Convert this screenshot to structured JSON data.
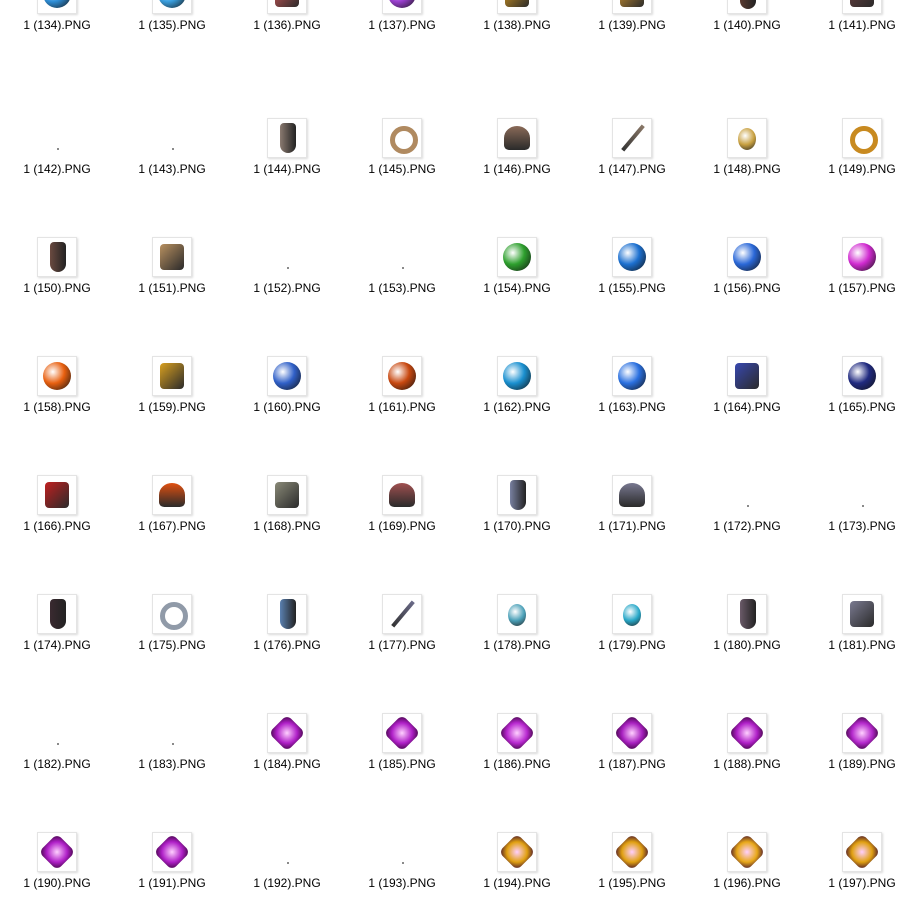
{
  "files": [
    {
      "name": "1 (134).PNG",
      "icon": "blue-gem-icon",
      "color": "#2f8fd8"
    },
    {
      "name": "1 (135).PNG",
      "icon": "blue-gem-icon",
      "color": "#3aa0e0"
    },
    {
      "name": "1 (136).PNG",
      "icon": "red-scroll-icon",
      "color": "#d65a5a"
    },
    {
      "name": "1 (137).PNG",
      "icon": "purple-gem-icon",
      "color": "#9b3fd0"
    },
    {
      "name": "1 (138).PNG",
      "icon": "gold-box-icon",
      "color": "#e0a020"
    },
    {
      "name": "1 (139).PNG",
      "icon": "gold-ornament-icon",
      "color": "#d89a30"
    },
    {
      "name": "1 (140).PNG",
      "icon": "boots-icon",
      "color": "#5a3a30"
    },
    {
      "name": "1 (141).PNG",
      "icon": "armor-piece-icon",
      "color": "#6a4040"
    },
    {
      "name": "1 (142).PNG",
      "icon": "no-thumbnail",
      "color": ""
    },
    {
      "name": "1 (143).PNG",
      "icon": "no-thumbnail",
      "color": ""
    },
    {
      "name": "1 (144).PNG",
      "icon": "gauntlet-icon",
      "color": "#8a7a70"
    },
    {
      "name": "1 (145).PNG",
      "icon": "ring-icon",
      "color": "#b08a60"
    },
    {
      "name": "1 (146).PNG",
      "icon": "helmet-icon",
      "color": "#8a6a58"
    },
    {
      "name": "1 (147).PNG",
      "icon": "sword-icon",
      "color": "#8a7868"
    },
    {
      "name": "1 (148).PNG",
      "icon": "amulet-icon",
      "color": "#c8a040"
    },
    {
      "name": "1 (149).PNG",
      "icon": "ring-icon",
      "color": "#c88a20"
    },
    {
      "name": "1 (150).PNG",
      "icon": "boots-icon",
      "color": "#6a4a40"
    },
    {
      "name": "1 (151).PNG",
      "icon": "armor-skirt-icon",
      "color": "#b89060"
    },
    {
      "name": "1 (152).PNG",
      "icon": "no-thumbnail",
      "color": ""
    },
    {
      "name": "1 (153).PNG",
      "icon": "no-thumbnail",
      "color": ""
    },
    {
      "name": "1 (154).PNG",
      "icon": "green-orb-icon",
      "color": "#2ea02e"
    },
    {
      "name": "1 (155).PNG",
      "icon": "blue-orb-icon",
      "color": "#1c70d0"
    },
    {
      "name": "1 (156).PNG",
      "icon": "blue-orb-icon",
      "color": "#2a68d8"
    },
    {
      "name": "1 (157).PNG",
      "icon": "magenta-orb-icon",
      "color": "#d02ad0"
    },
    {
      "name": "1 (158).PNG",
      "icon": "fire-orb-icon",
      "color": "#e86010"
    },
    {
      "name": "1 (159).PNG",
      "icon": "gold-dragon-icon",
      "color": "#d8a020"
    },
    {
      "name": "1 (160).PNG",
      "icon": "blue-crystal-icon",
      "color": "#3060c8"
    },
    {
      "name": "1 (161).PNG",
      "icon": "fire-rock-icon",
      "color": "#c84810"
    },
    {
      "name": "1 (162).PNG",
      "icon": "blue-skull-orb-icon",
      "color": "#1a90d0"
    },
    {
      "name": "1 (163).PNG",
      "icon": "blue-crystal-icon",
      "color": "#2a70e0"
    },
    {
      "name": "1 (164).PNG",
      "icon": "portal-icon",
      "color": "#3848b0"
    },
    {
      "name": "1 (165).PNG",
      "icon": "dark-blue-orb-icon",
      "color": "#202a80"
    },
    {
      "name": "1 (166).PNG",
      "icon": "red-seal-icon",
      "color": "#c02020"
    },
    {
      "name": "1 (167).PNG",
      "icon": "pumpkin-hat-icon",
      "color": "#e05010"
    },
    {
      "name": "1 (168).PNG",
      "icon": "stone-scroll-icon",
      "color": "#8a8a78"
    },
    {
      "name": "1 (169).PNG",
      "icon": "skull-helmet-icon",
      "color": "#a05050"
    },
    {
      "name": "1 (170).PNG",
      "icon": "boots-icon",
      "color": "#7880a0"
    },
    {
      "name": "1 (171).PNG",
      "icon": "helmet-icon",
      "color": "#787890"
    },
    {
      "name": "1 (172).PNG",
      "icon": "no-thumbnail",
      "color": ""
    },
    {
      "name": "1 (173).PNG",
      "icon": "no-thumbnail",
      "color": ""
    },
    {
      "name": "1 (174).PNG",
      "icon": "dark-gauntlet-icon",
      "color": "#3a2a30"
    },
    {
      "name": "1 (175).PNG",
      "icon": "silver-ring-icon",
      "color": "#909aa8"
    },
    {
      "name": "1 (176).PNG",
      "icon": "blue-gauntlet-icon",
      "color": "#5a80b0"
    },
    {
      "name": "1 (177).PNG",
      "icon": "spear-icon",
      "color": "#6a6a88"
    },
    {
      "name": "1 (178).PNG",
      "icon": "amulet-icon",
      "color": "#4aa0b8"
    },
    {
      "name": "1 (179).PNG",
      "icon": "potion-icon",
      "color": "#28a8c8"
    },
    {
      "name": "1 (180).PNG",
      "icon": "boots-icon",
      "color": "#6a5a68"
    },
    {
      "name": "1 (181).PNG",
      "icon": "armor-piece-icon",
      "color": "#7a7a90"
    },
    {
      "name": "1 (182).PNG",
      "icon": "no-thumbnail",
      "color": ""
    },
    {
      "name": "1 (183).PNG",
      "icon": "no-thumbnail",
      "color": ""
    },
    {
      "name": "1 (184).PNG",
      "icon": "purple-rune-stone-icon",
      "color": "#b020c8"
    },
    {
      "name": "1 (185).PNG",
      "icon": "purple-rune-stone-icon",
      "color": "#b020c8"
    },
    {
      "name": "1 (186).PNG",
      "icon": "purple-rune-stone-icon",
      "color": "#b828d0"
    },
    {
      "name": "1 (187).PNG",
      "icon": "purple-rune-stone-icon",
      "color": "#a820c0"
    },
    {
      "name": "1 (188).PNG",
      "icon": "purple-rune-stone-icon",
      "color": "#b020c8"
    },
    {
      "name": "1 (189).PNG",
      "icon": "purple-rune-stone-icon",
      "color": "#b428cc"
    },
    {
      "name": "1 (190).PNG",
      "icon": "purple-rune-stone-icon",
      "color": "#b020c8"
    },
    {
      "name": "1 (191).PNG",
      "icon": "purple-rune-stone-icon",
      "color": "#b020c8"
    },
    {
      "name": "1 (192).PNG",
      "icon": "no-thumbnail",
      "color": ""
    },
    {
      "name": "1 (193).PNG",
      "icon": "no-thumbnail",
      "color": ""
    },
    {
      "name": "1 (194).PNG",
      "icon": "gold-rune-stone-icon",
      "color": "#e0a010"
    },
    {
      "name": "1 (195).PNG",
      "icon": "gold-rune-stone-icon",
      "color": "#e0a010"
    },
    {
      "name": "1 (196).PNG",
      "icon": "gold-rune-stone-icon",
      "color": "#e8a818"
    },
    {
      "name": "1 (197).PNG",
      "icon": "gold-rune-stone-icon",
      "color": "#e0a010"
    }
  ]
}
